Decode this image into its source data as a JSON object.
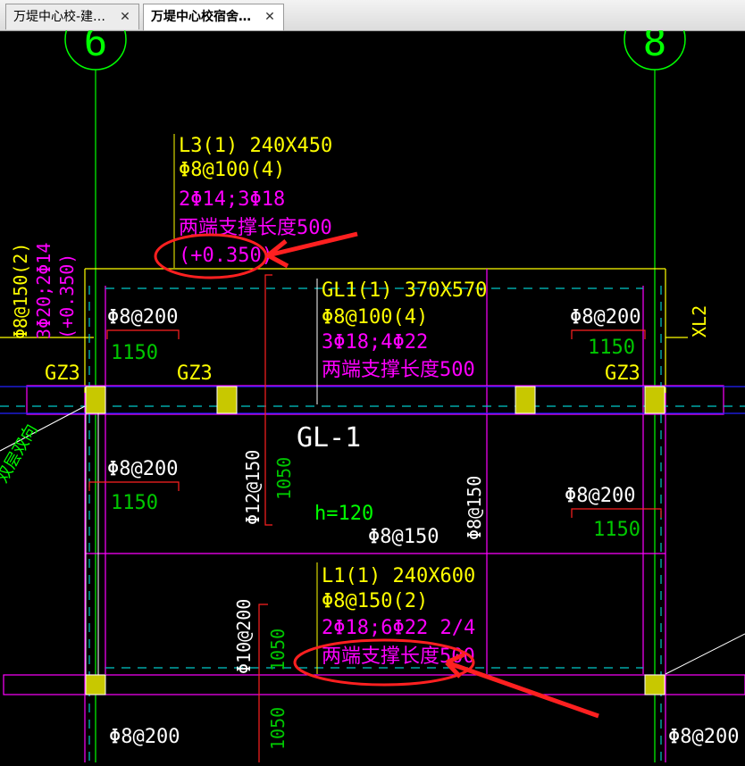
{
  "tabs": [
    {
      "label": "万堤中心校-建…",
      "active": false
    },
    {
      "label": "万堤中心校宿舍…",
      "active": true
    }
  ],
  "close_glyph": "✕",
  "axes": {
    "left": "6",
    "right": "8"
  },
  "annotations": {
    "l3": [
      "L3(1) 240X450",
      "Φ8@100(4)",
      "2Φ14;3Φ18",
      "两端支撑长度500",
      "(+0.350)"
    ],
    "gl1": [
      "GL1(1) 370X570",
      "Φ8@100(4)",
      "3Φ18;4Φ22",
      "两端支撑长度500"
    ],
    "l1": [
      "L1(1) 240X600",
      "Φ8@150(2)",
      "2Φ18;6Φ22 2/4",
      "两端支撑长度500"
    ],
    "left_vertical": [
      "Φ8@150(2)",
      "3Φ20;2Φ14",
      "(+0.350)"
    ],
    "xl2": "XL2",
    "gz3": "GZ3",
    "gl_label": "GL-1",
    "h_label": "h=120",
    "slab_rebar": "Φ8@200",
    "slab_len": "1150",
    "len_1050": "1050",
    "phi12": "Φ12@150",
    "phi8_150": "Φ8@150",
    "phi10": "Φ10@200",
    "side_text": "双层双向"
  },
  "colors": {
    "yellow": "#ffff00",
    "magenta": "#ff00ff",
    "green": "#00ff00",
    "red": "#ff2020",
    "blue": "#2222ff",
    "cyan": "#00c8c8",
    "white": "#ffffff",
    "column": "#c8c800"
  }
}
